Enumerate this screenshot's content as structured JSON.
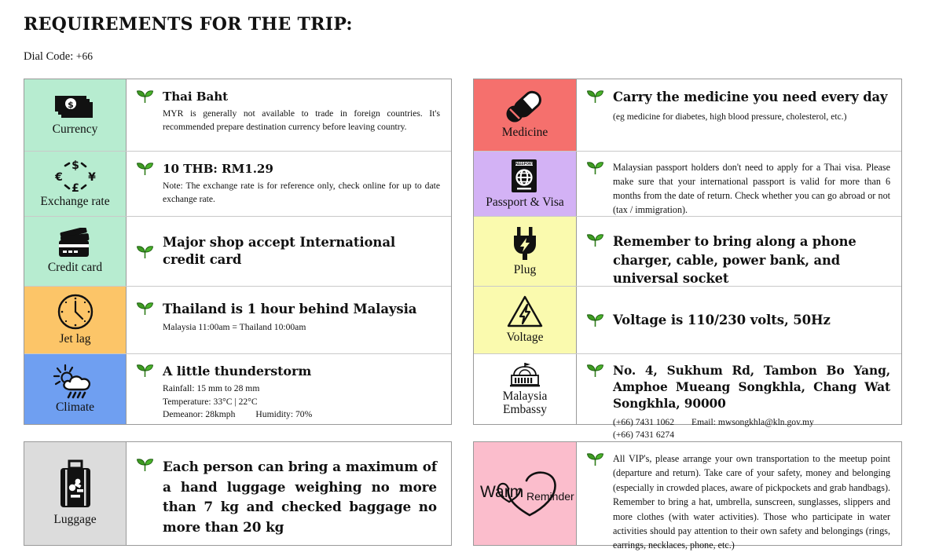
{
  "header": {
    "title": "REQUIREMENTS FOR THE TRIP:",
    "dial_label": "Dial Code:",
    "dial_value": "+66"
  },
  "icons": {
    "sprout": "sprout-icon",
    "currency": "banknote-dollar-icon",
    "exchange": "currency-exchange-circle-icon",
    "credit": "credit-cards-icon",
    "jetlag": "clock-icon",
    "climate": "sun-cloud-rain-icon",
    "luggage": "suitcase-icon",
    "medicine": "pills-capsule-icon",
    "passport": "passport-book-icon",
    "plug": "power-plug-icon",
    "voltage": "high-voltage-triangle-icon",
    "embassy": "embassy-building-icon",
    "warm": "warm-reminder-hearts-logo"
  },
  "colors": {
    "mint": "#b7ecd0",
    "orange": "#fcc568",
    "blue": "#6f9ff1",
    "gray": "#dcdcdc",
    "red": "#f5706d",
    "purple": "#d3b2f5",
    "yellow": "#fafaae",
    "white": "#ffffff",
    "pink": "#fbbdcc",
    "sprout_green": "#3f9b23",
    "border": "#9a9a9a"
  },
  "left_table": {
    "rows": [
      {
        "label": "Currency",
        "bg": "#b7ecd0",
        "heading": "Thai Baht",
        "sub": "MYR is generally not available to trade in foreign countries. It's recommended prepare destination currency before leaving country."
      },
      {
        "label": "Exchange rate",
        "bg": "#b7ecd0",
        "heading": "10 THB: RM1.29",
        "sub": "Note: The exchange rate is for reference only, check online for up to date exchange rate."
      },
      {
        "label": "Credit card",
        "bg": "#b7ecd0",
        "heading": "Major shop accept International credit card",
        "sub": ""
      },
      {
        "label": "Jet lag",
        "bg": "#fcc568",
        "heading": "Thailand is 1 hour behind Malaysia",
        "sub": "Malaysia 11:00am = Thailand 10:00am"
      },
      {
        "label": "Climate",
        "bg": "#6f9ff1",
        "heading": "A little thunderstorm",
        "sub_lines": [
          "Rainfall: 15 mm to 28 mm",
          "Temperature: 33°C | 22°C"
        ],
        "sub_pair": [
          "Demeanor: 28kmph",
          "Humidity: 70%"
        ]
      }
    ]
  },
  "left_box": {
    "label": "Luggage",
    "bg": "#dcdcdc",
    "heading": "Each person can bring a maximum of a hand luggage weighing no more than 7 kg and checked baggage no more than 20 kg"
  },
  "right_table": {
    "rows": [
      {
        "label": "Medicine",
        "bg": "#f5706d",
        "heading": "Carry the medicine you need every day",
        "sub": "(eg medicine for diabetes, high blood pressure, cholesterol, etc.)"
      },
      {
        "label": "Passport & Visa",
        "bg": "#d3b2f5",
        "heading": "",
        "sub": "Malaysian passport holders don't need to apply for a Thai visa. Please make sure that your international passport is valid for more than 6 months from the date of return. Check whether you can go abroad or not (tax / immigration)."
      },
      {
        "label": "Plug",
        "bg": "#fafaae",
        "heading": "Remember to bring along a phone charger, cable, power bank, and universal socket",
        "sub": ""
      },
      {
        "label": "Voltage",
        "bg": "#fafaae",
        "heading": "Voltage is 110/230 volts, 50Hz",
        "sub": ""
      },
      {
        "label_line1": "Malaysia",
        "label_line2": "Embassy",
        "bg": "#ffffff",
        "heading": "No. 4, Sukhum Rd, Tambon Bo Yang, Amphoe Mueang Songkhla, Chang Wat Songkhla, 90000",
        "phone1": "(+66) 7431 1062",
        "email": "Email: mwsongkhla@kln.gov.my",
        "phone2": "(+66) 7431 6274"
      }
    ]
  },
  "right_box": {
    "logo_word1": "Warm",
    "logo_word2": "Reminder",
    "bg": "#fbbdcc",
    "body": "All VIP's, please arrange your own transportation to the meetup point (departure and return). Take care of your safety, money and belonging (especially in crowded places, aware of pickpockets and grab handbags). Remember to bring a hat, umbrella, sunscreen, sunglasses, slippers and more clothes (with water activities). Those who participate in water activities should pay attention to their own safety and belongings (rings, earrings, necklaces, phone, etc.)"
  }
}
